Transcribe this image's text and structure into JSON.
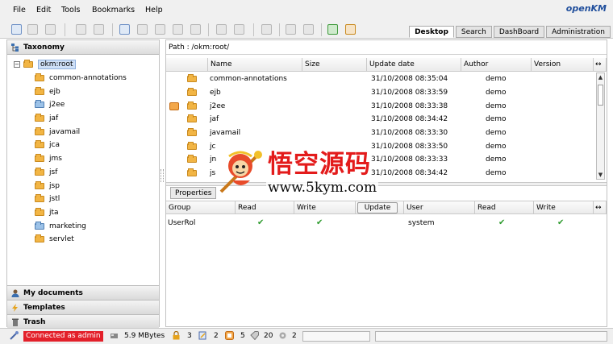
{
  "menu": [
    "File",
    "Edit",
    "Tools",
    "Bookmarks",
    "Help"
  ],
  "logo": "openKM",
  "tabs": [
    {
      "label": "Desktop",
      "selected": true
    },
    {
      "label": "Search",
      "selected": false
    },
    {
      "label": "DashBoard",
      "selected": false
    },
    {
      "label": "Administration",
      "selected": false
    }
  ],
  "taxonomy": {
    "title": "Taxonomy",
    "root": "okm:root",
    "folders": [
      "common-annotations",
      "ejb",
      "j2ee",
      "jaf",
      "javamail",
      "jca",
      "jms",
      "jsf",
      "jsp",
      "jstl",
      "jta",
      "marketing",
      "servlet"
    ]
  },
  "accordion": [
    "My documents",
    "Templates",
    "Trash"
  ],
  "path": "Path : /okm:root/",
  "grid": {
    "columns": [
      "Name",
      "Size",
      "Update date",
      "Author",
      "Version"
    ],
    "rows": [
      {
        "name": "common-annotations",
        "date": "31/10/2008 08:35:04",
        "author": "demo"
      },
      {
        "name": "ejb",
        "date": "31/10/2008 08:33:59",
        "author": "demo"
      },
      {
        "name": "j2ee",
        "date": "31/10/2008 08:33:38",
        "author": "demo"
      },
      {
        "name": "jaf",
        "date": "31/10/2008 08:34:42",
        "author": "demo"
      },
      {
        "name": "javamail",
        "date": "31/10/2008 08:33:30",
        "author": "demo"
      },
      {
        "name": "jc",
        "date": "31/10/2008 08:33:50",
        "author": "demo"
      },
      {
        "name": "jn",
        "date": "31/10/2008 08:33:33",
        "author": "demo"
      },
      {
        "name": "js",
        "date": "31/10/2008 08:34:42",
        "author": "demo"
      }
    ]
  },
  "properties_tab": "Properties",
  "permissions": {
    "group_headers": [
      "Group",
      "Read",
      "Write"
    ],
    "update_label": "Update",
    "user_headers": [
      "User",
      "Read",
      "Write"
    ],
    "group_row": "UserRol",
    "user_row": "system",
    "check": "✔"
  },
  "watermark": {
    "title": "悟空源码",
    "url": "www.5kym.com"
  },
  "status": {
    "connected": "Connected as admin",
    "size": "5.9 MBytes",
    "locked": "3",
    "checkout": "2",
    "subscribed": "5",
    "subscribed_docs": "20",
    "workflows": "2"
  }
}
